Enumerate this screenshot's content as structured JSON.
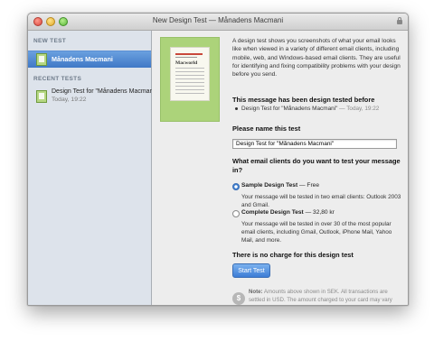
{
  "window": {
    "title": "New Design Test — Månadens Macmani"
  },
  "sidebar": {
    "new_test_heading": "NEW TEST",
    "new_test_item": "Månadens Macmani",
    "recent_heading": "RECENT TESTS",
    "recent_items": [
      {
        "title": "Design Test for \"Månadens Macmani\"",
        "time": "Today, 19:22"
      }
    ]
  },
  "main": {
    "preview": {
      "brand": "Macworld"
    },
    "description": "A design test shows you screenshots of what your email looks like when viewed in a variety of different email clients, including mobile, web, and Windows-based email clients. They are useful for identifying and fixing compatibility problems with your design before you send.",
    "tested_before_heading": "This message has been design tested before",
    "tested_before_item": {
      "title": "Design Test for \"Månadens Macmani\"",
      "separator": " — ",
      "time": "Today, 19:22"
    },
    "name_heading": "Please name this test",
    "name_value": "Design Test for \"Månadens Macmani\"",
    "clients_heading": "What email clients do you want to test your message in?",
    "options": [
      {
        "label": "Sample Design Test",
        "price": " — Free",
        "desc": "Your message will be tested in two email clients: Outlook 2003 and Gmail.",
        "selected": true
      },
      {
        "label": "Complete Design Test",
        "price": " — 32,80 kr",
        "desc": "Your message will be tested in over 30 of the most popular email clients, including Gmail, Outlook, iPhone Mail, Yahoo Mail, and more.",
        "selected": false
      }
    ],
    "no_charge_heading": "There is no charge for this design test",
    "start_button": "Start Test",
    "note_label": "Note:",
    "note_text": " Amounts above shown in SEK. All transactions are settled in USD. The amount charged to your card may vary slightly depending on exchange rates at time of settlement."
  },
  "colors": {
    "accent": "#3f78c6",
    "preview_bg": "#acd37a"
  }
}
